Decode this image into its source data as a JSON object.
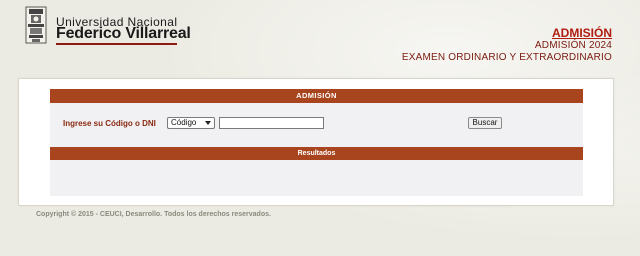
{
  "header": {
    "university_line1": "Universidad Nacional",
    "university_line2": "Federico Villarreal",
    "title": "ADMISIÓN",
    "subtitle1": "ADMISIÓN 2024",
    "subtitle2": "EXAMEN ORDINARIO Y EXTRAORDINARIO"
  },
  "form": {
    "section_title": "ADMISIÓN",
    "label": "Ingrese su Código o DNI",
    "select_value": "Código",
    "input_value": "",
    "search_button": "Buscar"
  },
  "results": {
    "section_title": "Resultados"
  },
  "footer": {
    "copyright": "Copyright © 2015 - CEUCI, Desarrollo. Todos los derechos reservados."
  },
  "colors": {
    "accent_bar": "#a8441e",
    "title_red": "#b01d12"
  },
  "icons": {
    "crest": "university-crest-icon",
    "select_caret": "chevron-down-icon"
  }
}
